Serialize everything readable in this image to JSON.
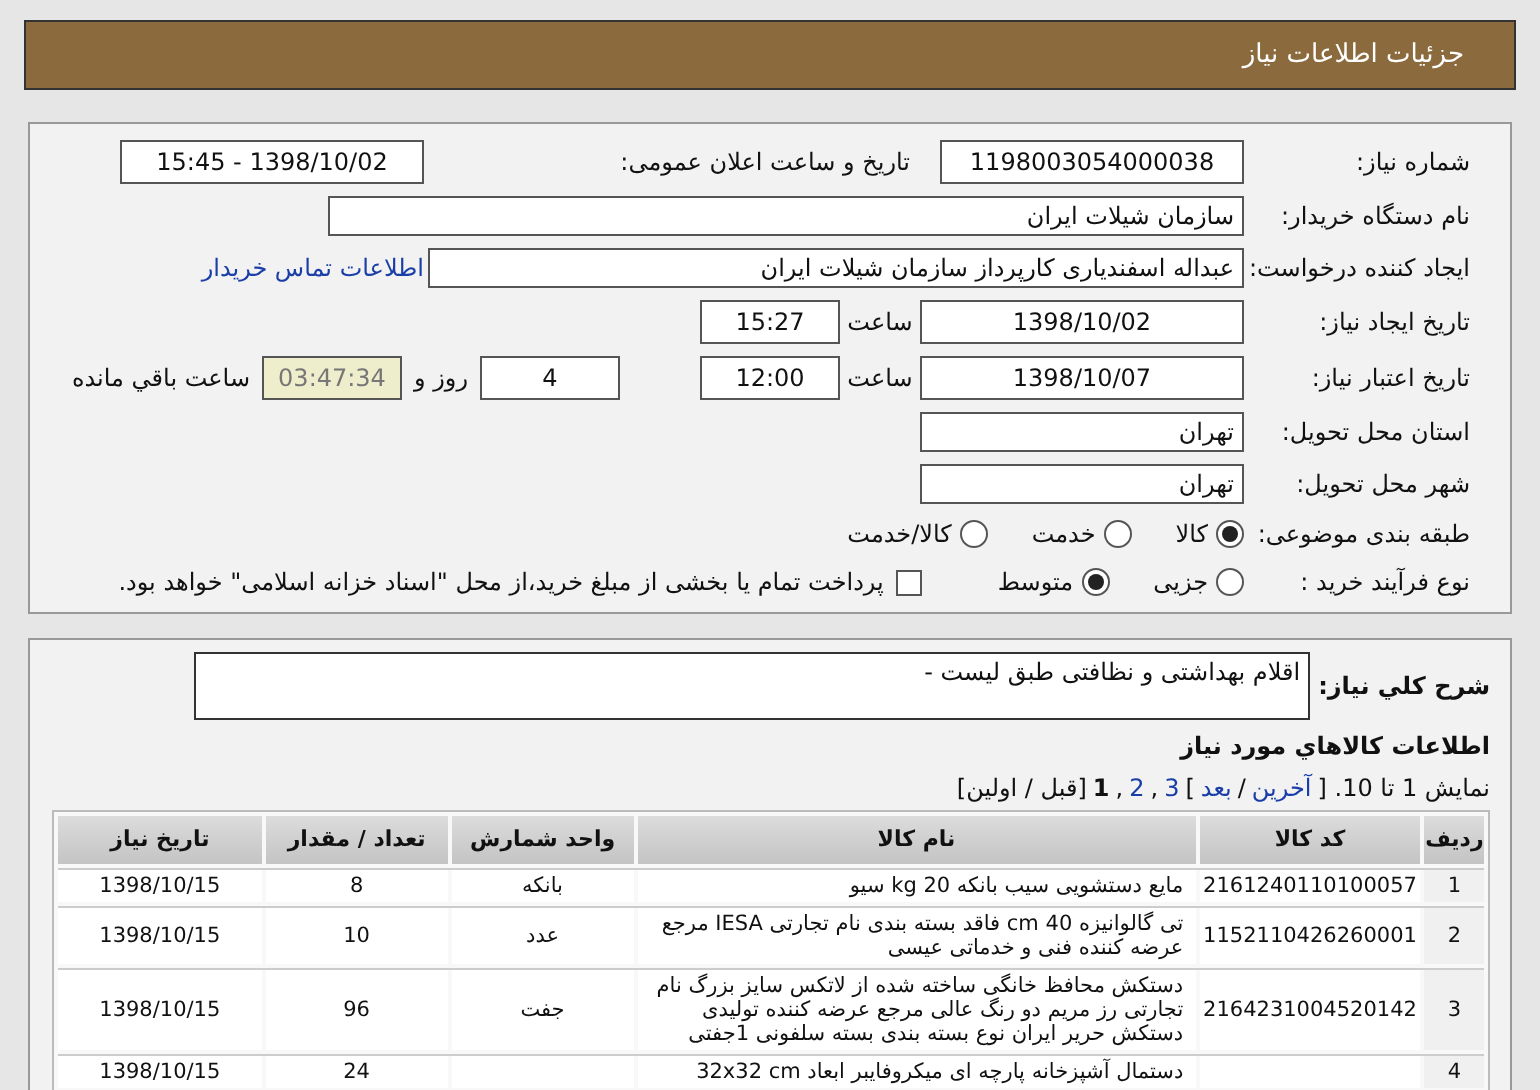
{
  "header": {
    "title": "جزئیات اطلاعات نیاز"
  },
  "details": {
    "need_number": {
      "label": "شماره نیاز:",
      "value": "1198003054000038"
    },
    "announce": {
      "label": "تاریخ و ساعت اعلان عمومی:",
      "value": "1398/10/02 - 15:45"
    },
    "buyer": {
      "label": "نام دستگاه خریدار:",
      "value": "سازمان شیلات ایران"
    },
    "creator": {
      "label": "ایجاد کننده درخواست:",
      "value": "عبداله اسفندیاری کارپرداز سازمان شیلات ایران",
      "link": "اطلاعات تماس خریدار"
    },
    "created": {
      "label": "تاریخ ایجاد نیاز:",
      "date": "1398/10/02",
      "time_label": "ساعت",
      "time": "15:27"
    },
    "valid": {
      "label": "تاریخ اعتبار نیاز:",
      "date": "1398/10/07",
      "time_label": "ساعت",
      "time": "12:00",
      "days": "4",
      "days_label": "روز و",
      "remaining": "03:47:34",
      "remaining_label": "ساعت باقي مانده"
    },
    "province": {
      "label": "استان محل تحویل:",
      "value": "تهران"
    },
    "city": {
      "label": "شهر محل تحویل:",
      "value": "تهران"
    },
    "category": {
      "label": "طبقه بندی موضوعی:",
      "options": [
        {
          "label": "کالا",
          "selected": true
        },
        {
          "label": "خدمت",
          "selected": false
        },
        {
          "label": "کالا/خدمت",
          "selected": false
        }
      ]
    },
    "process": {
      "label": "نوع فرآیند خرید :",
      "options": [
        {
          "label": "جزیی",
          "selected": false
        },
        {
          "label": "متوسط",
          "selected": true
        }
      ],
      "treasury": {
        "label": "پرداخت تمام یا بخشی از مبلغ خرید،از محل \"اسناد خزانه اسلامی\" خواهد بود.",
        "checked": false
      }
    }
  },
  "description": {
    "label": "شرح کلي نياز:",
    "value": "اقلام بهداشتی و نظافتی طبق لیست -"
  },
  "goods": {
    "title": "اطلاعات کالاهاي مورد نياز",
    "pagination": [
      {
        "kind": "text",
        "label": "نمایش 1 تا 10. ["
      },
      {
        "kind": "link",
        "label": "آخرین"
      },
      {
        "kind": "text",
        "label": "/"
      },
      {
        "kind": "link",
        "label": "بعد"
      },
      {
        "kind": "text",
        "label": "]"
      },
      {
        "kind": "link",
        "label": "3"
      },
      {
        "kind": "text",
        "label": ","
      },
      {
        "kind": "link",
        "label": "2"
      },
      {
        "kind": "text",
        "label": ","
      },
      {
        "kind": "current",
        "label": "1"
      },
      {
        "kind": "text",
        "label": "[قبل / اولین]"
      }
    ],
    "columns": [
      "ردیف",
      "کد کالا",
      "نام کالا",
      "واحد شمارش",
      "تعداد / مقدار",
      "تاریخ نیاز"
    ],
    "rows": [
      {
        "index": "1",
        "code": "2161240110100057",
        "name": "مایع دستشویی سیب بانکه 20 kg سیو",
        "unit": "بانکه",
        "qty": "8",
        "date": "1398/10/15"
      },
      {
        "index": "2",
        "code": "1152110426260001",
        "name": "تی گالوانیزه 40 cm فاقد بسته بندی نام تجارتی IESA مرجع عرضه کننده فنی و خدماتی عیسی",
        "unit": "عدد",
        "qty": "10",
        "date": "1398/10/15"
      },
      {
        "index": "3",
        "code": "2164231004520142",
        "name": "دستکش محافظ خانگی ساخته شده از لاتکس سایز بزرگ نام تجارتی رز مریم دو رنگ عالی مرجع عرضه کننده تولیدی دستکش حریر ایران نوع بسته بندی بسته سلفونی 1جفتی",
        "unit": "جفت",
        "qty": "96",
        "date": "1398/10/15"
      },
      {
        "index": "4",
        "name": "دستمال آشپزخانه پارچه ای میکروفایبر ابعاد 32x32 cm",
        "qty": "24",
        "date": "1398/10/15"
      }
    ]
  }
}
